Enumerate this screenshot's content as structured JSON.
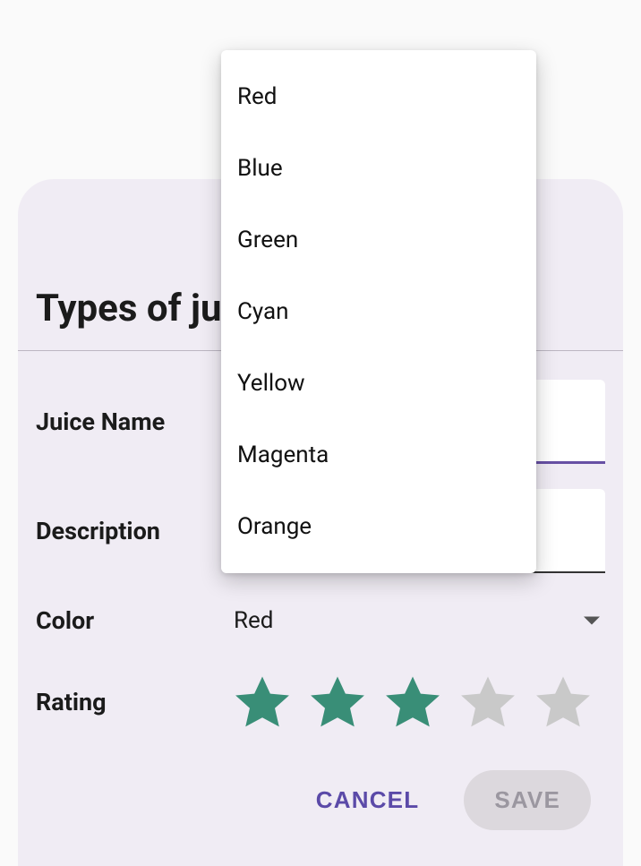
{
  "dialog": {
    "title": "Types of juice",
    "fields": {
      "name_label": "Juice Name",
      "name_value": "",
      "desc_label": "Description",
      "desc_value": "",
      "color_label": "Color",
      "color_selected": "Red",
      "rating_label": "Rating",
      "rating_value": 3,
      "rating_max": 5
    },
    "actions": {
      "cancel": "CANCEL",
      "save": "SAVE"
    }
  },
  "dropdown": {
    "items": [
      "Red",
      "Blue",
      "Green",
      "Cyan",
      "Yellow",
      "Magenta",
      "Orange"
    ]
  },
  "colors": {
    "star_filled": "#398e77",
    "star_empty": "#c9c9c9",
    "primary": "#5b4aa8"
  }
}
